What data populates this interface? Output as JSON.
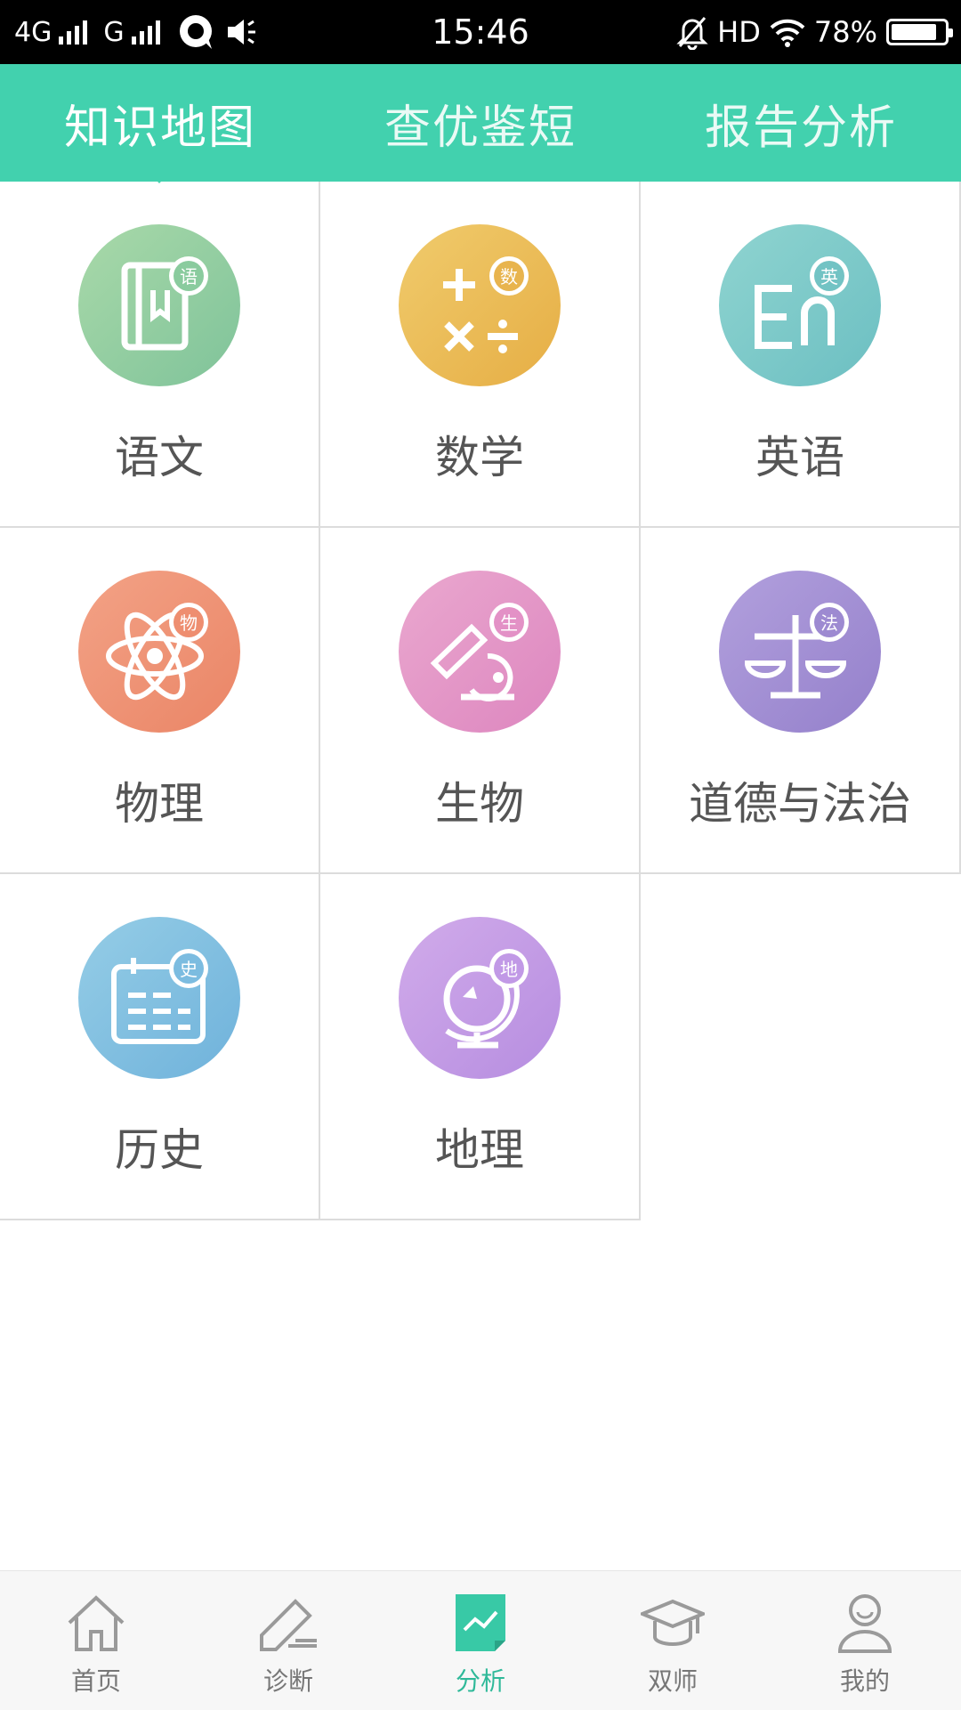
{
  "status_bar": {
    "network_left": "4G",
    "network_right": "G",
    "time": "15:46",
    "hd": "HD",
    "battery": "78%",
    "battery_level": 0.78
  },
  "tabs": [
    {
      "label": "知识地图",
      "active": true
    },
    {
      "label": "查优鉴短",
      "active": false
    },
    {
      "label": "报告分析",
      "active": false
    }
  ],
  "subjects": [
    {
      "label": "语文",
      "badge": "语",
      "icon": "book-icon",
      "color": "#93cfa0"
    },
    {
      "label": "数学",
      "badge": "数",
      "icon": "math-operators-icon",
      "color": "#ecbf5b"
    },
    {
      "label": "英语",
      "badge": "英",
      "icon": "en-letters-icon",
      "color": "#7fcbcb"
    },
    {
      "label": "物理",
      "badge": "物",
      "icon": "atom-icon",
      "color": "#ef9678"
    },
    {
      "label": "生物",
      "badge": "生",
      "icon": "microscope-icon",
      "color": "#e69bc8"
    },
    {
      "label": "道德与法治",
      "badge": "法",
      "icon": "scales-icon",
      "color": "#a492d4"
    },
    {
      "label": "历史",
      "badge": "史",
      "icon": "calendar-icon",
      "color": "#86c3e2"
    },
    {
      "label": "地理",
      "badge": "地",
      "icon": "globe-icon",
      "color": "#c29be6"
    }
  ],
  "bottom_nav": [
    {
      "label": "首页",
      "icon": "home-icon",
      "active": false
    },
    {
      "label": "诊断",
      "icon": "edit-icon",
      "active": false
    },
    {
      "label": "分析",
      "icon": "analysis-chart-icon",
      "active": true
    },
    {
      "label": "双师",
      "icon": "graduation-cap-icon",
      "active": false
    },
    {
      "label": "我的",
      "icon": "user-icon",
      "active": false
    }
  ],
  "colors": {
    "tab_bar": "#42d1ae",
    "nav_active": "#2fb999",
    "nav_inactive": "#777777"
  }
}
